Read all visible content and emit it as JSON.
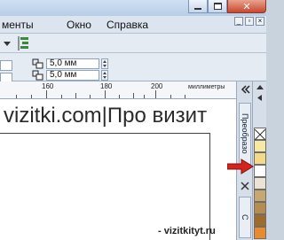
{
  "menubar": {
    "items": [
      "менты",
      "Окно",
      "Справка"
    ]
  },
  "toolbar2": {
    "width_value": "5,0 мм",
    "height_value": "5,0 мм"
  },
  "ruler": {
    "labels": [
      "160",
      "180",
      "200"
    ],
    "unit": "миллиметры"
  },
  "watermark": "vizitki.com|Про визит",
  "footer": "- vizitkityt.ru",
  "dock": {
    "tab_top": "Преобразо",
    "tab_bottom": "С"
  },
  "colors": {
    "titlebar": "#c4d6ec",
    "close": "#c8472b",
    "arrow": "#d8231c"
  }
}
